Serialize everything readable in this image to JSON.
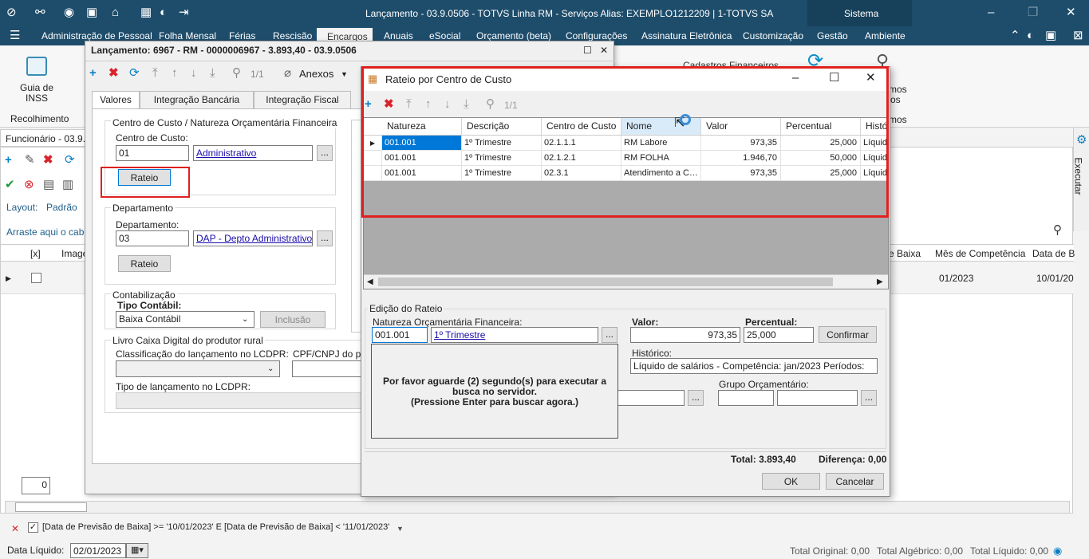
{
  "titlebar": {
    "title": "Lançamento - 03.9.0506 - TOTVS Linha RM - Serviços  Alias: EXEMPLO1212209 | 1-TOTVS SA",
    "sistema": "Sistema"
  },
  "menu": [
    "Administração de Pessoal",
    "Folha Mensal",
    "Férias",
    "Rescisão",
    "Encargos",
    "Anuais",
    "eSocial",
    "Orçamento (beta)",
    "Configurações",
    "Assinatura Eletrônica",
    "Customização",
    "Gestão",
    "Ambiente"
  ],
  "ribbon": {
    "guia_label": "Guia de INSS",
    "group_label": "Recolhimento",
    "cadastros": "Cadastros Financeiros",
    "partial1": "mos",
    "partial2": "os",
    "partial3": "mos"
  },
  "left": {
    "tab_label": "Funcionário - 03.9.0",
    "layout_label": "Layout:",
    "layout_value": "Padrão",
    "drag_hint": "Arraste aqui o cabeç",
    "col_x": "[x]",
    "col_image": "Image",
    "col_baixa": "e Baixa",
    "col_mes": "Mês de Competência",
    "col_data": "Data de B",
    "row_mes": "01/2023",
    "row_data": "10/01/20",
    "page_num": "0",
    "filter": "[Data de Previsão de Baixa] >= '10/01/2023' E [Data de Previsão de Baixa] < '11/01/2023'",
    "data_liquido_label": "Data Líquido:",
    "data_liquido_value": "02/01/2023",
    "executar": "Executar"
  },
  "totals": {
    "original": "Total Original: 0,00",
    "algebrico": "Total Algébrico: 0,00",
    "liquido": "Total Líquido: 0,00"
  },
  "lanc": {
    "title": "Lançamento: 6967 - RM - 0000006967 - 3.893,40 - 03.9.0506",
    "nav": "1/1",
    "anexos": "Anexos",
    "tabs": [
      "Valores",
      "Integração Bancária",
      "Integração Fiscal"
    ],
    "cc_group": "Centro de Custo / Natureza Orçamentária Financeira",
    "cc_label": "Centro de Custo:",
    "cc_code": "01",
    "cc_name": "Administrativo",
    "rateio1": "Rateio",
    "dep_group": "Departamento",
    "dep_label": "Departamento:",
    "dep_code": "03",
    "dep_name": "DAP - Depto Administrativo",
    "rateio2": "Rateio",
    "cont_group": "Contabilização",
    "tipo_label": "Tipo Contábil:",
    "tipo_value": "Baixa Contábil",
    "inclusao": "Inclusão",
    "livro_group": "Livro Caixa Digital do produtor rural",
    "class_label": "Classificação do lançamento no LCDPR:",
    "cpf_label": "CPF/CNPJ do part",
    "tipo_lanc_label": "Tipo de lançamento no LCDPR:"
  },
  "rateio": {
    "title": "Rateio por Centro de Custo",
    "nav": "1/1",
    "columns": [
      "Natureza",
      "Descrição",
      "Centro de Custo",
      "Nome",
      "Valor",
      "Percentual",
      "Histór"
    ],
    "rows": [
      [
        "001.001",
        "1º Trimestre",
        "02.1.1.1",
        "RM Labore",
        "973,35",
        "25,000",
        "Líquid"
      ],
      [
        "001.001",
        "1º Trimestre",
        "02.1.2.1",
        "RM FOLHA",
        "1.946,70",
        "50,000",
        "Líquid"
      ],
      [
        "001.001",
        "1º Trimestre",
        "02.3.1",
        "Atendimento a C…",
        "973,35",
        "25,000",
        "Líquid"
      ]
    ],
    "edit_group": "Edição do Rateio",
    "nat_label": "Natureza Orçamentária Financeira:",
    "nat_code": "001.001",
    "nat_name": "1º Trimestre",
    "valor_label": "Valor:",
    "valor_value": "973,35",
    "perc_label": "Percentual:",
    "perc_value": "25,000",
    "confirmar": "Confirmar",
    "hist_label": "Histórico:",
    "hist_value": "Líquido de salários - Competência: jan/2023  Períodos:",
    "grupo_label": "Grupo Orçamentário:",
    "wait_line1": "Por favor aguarde (2) segundo(s) para executar a busca no servidor.",
    "wait_line2": "(Pressione Enter para buscar agora.)",
    "total": "Total: 3.893,40",
    "diferenca": "Diferença: 0,00",
    "ok": "OK",
    "cancelar": "Cancelar"
  },
  "colors": {
    "titlebar": "#1e4d6b",
    "highlight": "#e0201f",
    "accent": "#0078d7"
  }
}
